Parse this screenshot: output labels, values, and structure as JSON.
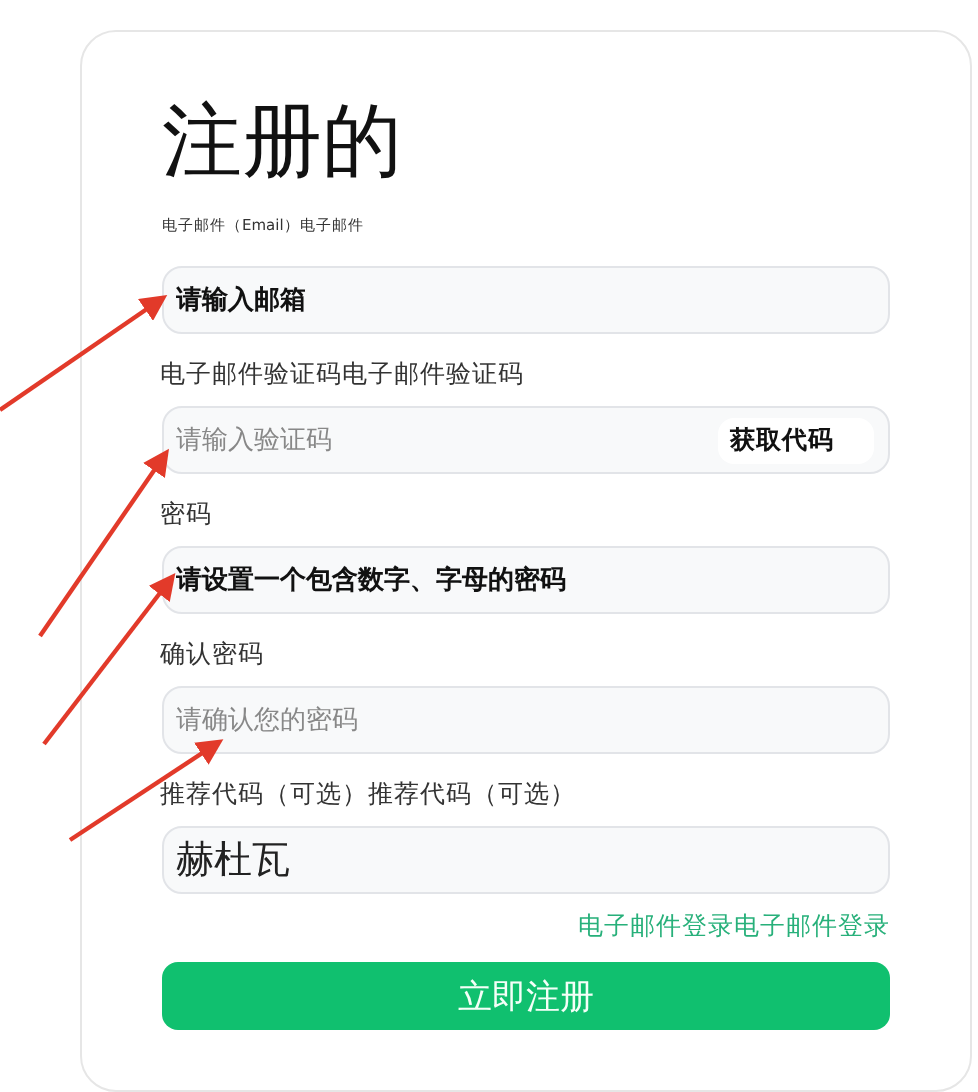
{
  "title": "注册的",
  "subtitle": "电子邮件（Email）电子邮件",
  "fields": [
    {
      "value": "请输入邮箱"
    },
    {
      "label": "电子邮件验证码电子邮件验证码",
      "placeholder": "请输入验证码",
      "button": "获取代码"
    },
    {
      "label": "密码",
      "value": "请设置一个包含数字、字母的密码"
    },
    {
      "label": "确认密码",
      "placeholder": "请确认您的密码"
    },
    {
      "label": "推荐代码（可选）推荐代码（可选）",
      "value": "赫杜瓦"
    }
  ],
  "login_link": "电子邮件登录电子邮件登录",
  "submit": "立即注册"
}
